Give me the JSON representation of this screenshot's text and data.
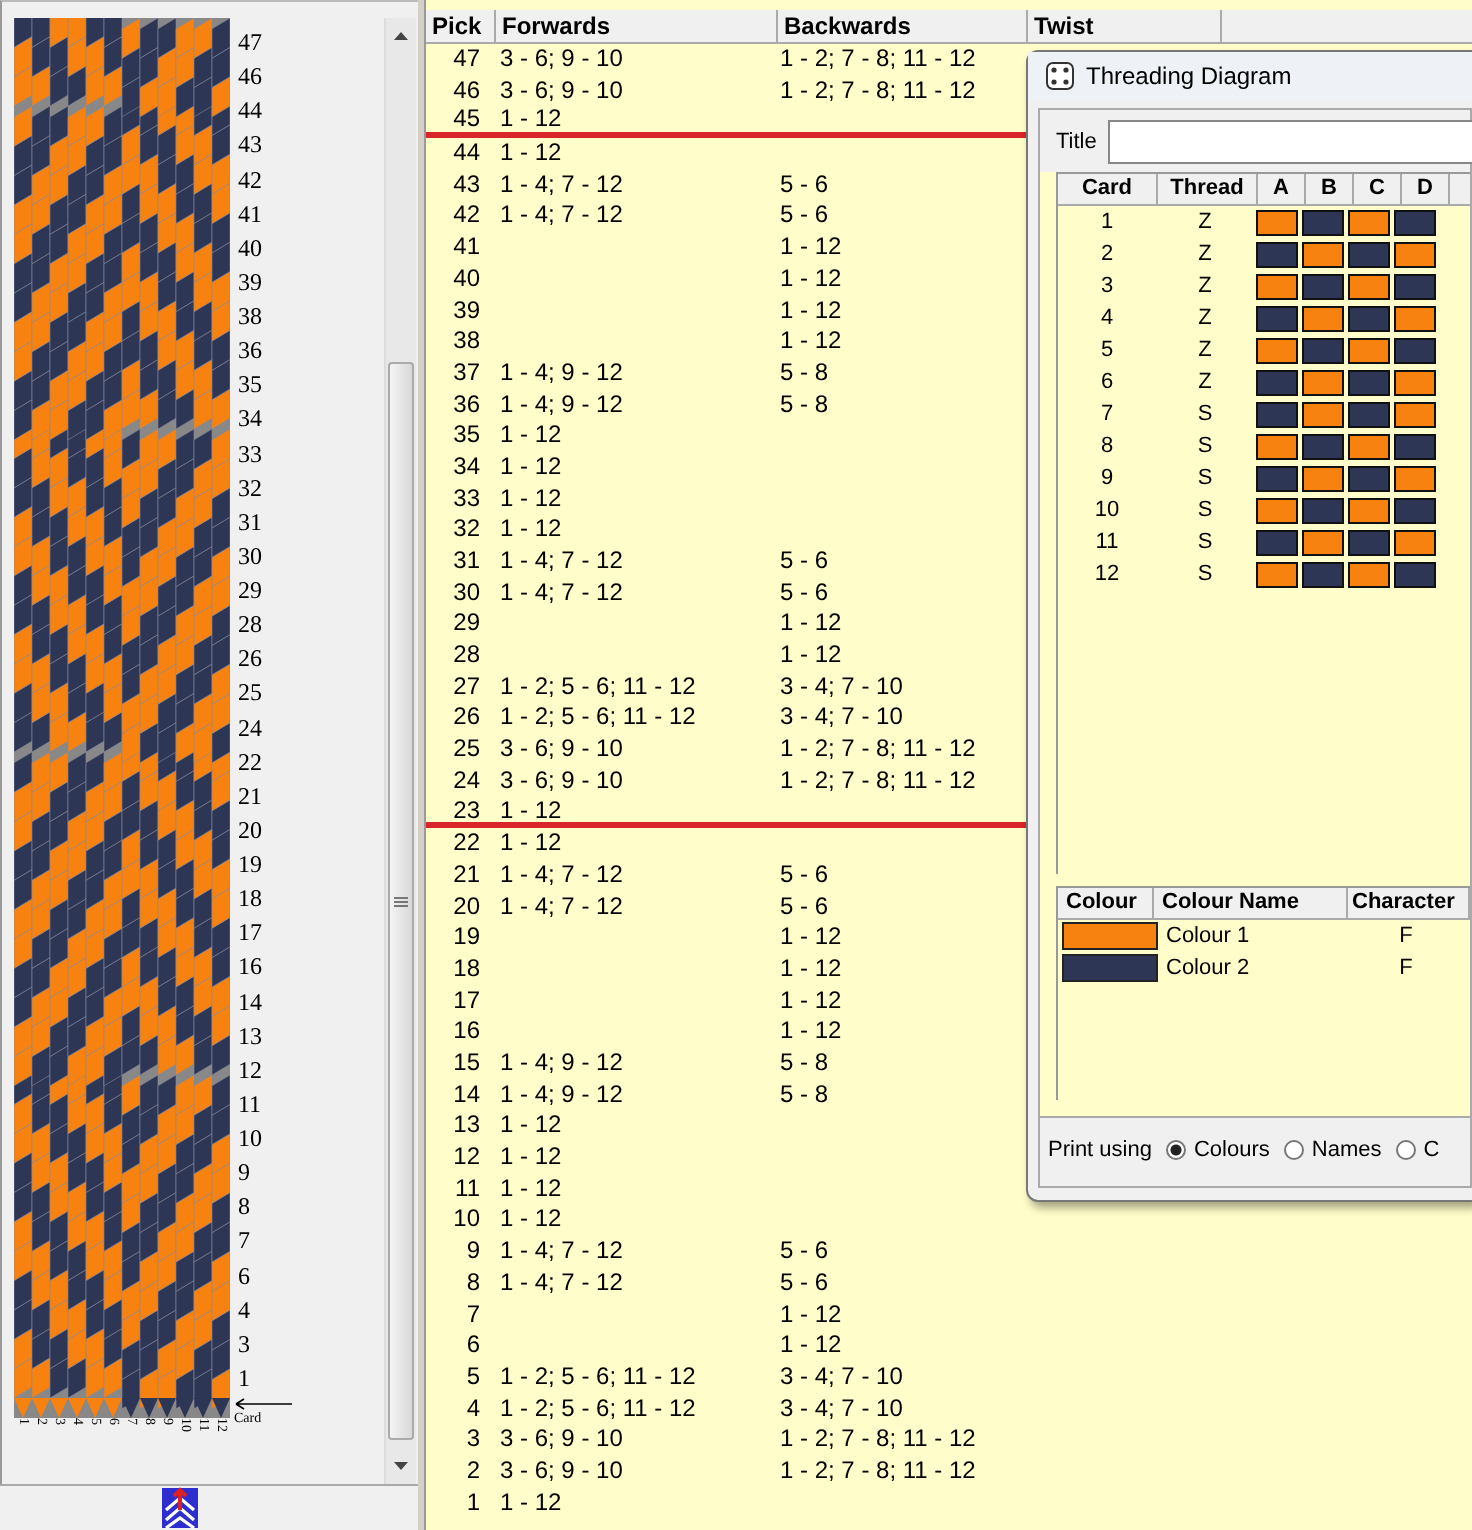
{
  "pattern_panel": {
    "pick_labels": [
      "47",
      "46",
      "44",
      "43",
      "42",
      "41",
      "40",
      "39",
      "38",
      "36",
      "35",
      "34",
      "33",
      "32",
      "31",
      "30",
      "29",
      "28",
      "26",
      "25",
      "24",
      "22",
      "21",
      "20",
      "19",
      "18",
      "17",
      "16",
      "14",
      "13",
      "12",
      "11",
      "10",
      "9",
      "8",
      "7",
      "6",
      "4",
      "3",
      "1"
    ],
    "card_numbers": [
      "1",
      "2",
      "3",
      "4",
      "5",
      "6",
      "7",
      "8",
      "9",
      "10",
      "11",
      "12"
    ],
    "card_label": "Card"
  },
  "pick_table": {
    "columns": [
      "Pick",
      "Forwards",
      "Backwards",
      "Twist"
    ],
    "rows": [
      {
        "pick": "47",
        "forwards": "3 - 6; 9 - 10",
        "backwards": "1 - 2; 7 - 8; 11 - 12",
        "divider_below": false
      },
      {
        "pick": "46",
        "forwards": "3 - 6; 9 - 10",
        "backwards": "1 - 2; 7 - 8; 11 - 12",
        "divider_below": false
      },
      {
        "pick": "45",
        "forwards": "1 - 12",
        "divider_below": true
      },
      {
        "pick": "44",
        "forwards": "1 - 12",
        "divider_below": false
      },
      {
        "pick": "43",
        "forwards": "1 - 4; 7 - 12",
        "backwards": "5 - 6",
        "divider_below": false
      },
      {
        "pick": "42",
        "forwards": "1 - 4; 7 - 12",
        "backwards": "5 - 6",
        "divider_below": false
      },
      {
        "pick": "41",
        "backwards": "1 - 12",
        "divider_below": false
      },
      {
        "pick": "40",
        "backwards": "1 - 12",
        "divider_below": false
      },
      {
        "pick": "39",
        "backwards": "1 - 12",
        "divider_below": false
      },
      {
        "pick": "38",
        "backwards": "1 - 12",
        "divider_below": false
      },
      {
        "pick": "37",
        "forwards": "1 - 4; 9 - 12",
        "backwards": "5 - 8",
        "divider_below": false
      },
      {
        "pick": "36",
        "forwards": "1 - 4; 9 - 12",
        "backwards": "5 - 8",
        "divider_below": false
      },
      {
        "pick": "35",
        "forwards": "1 - 12",
        "divider_below": false
      },
      {
        "pick": "34",
        "forwards": "1 - 12",
        "divider_below": false
      },
      {
        "pick": "33",
        "forwards": "1 - 12",
        "divider_below": false
      },
      {
        "pick": "32",
        "forwards": "1 - 12",
        "divider_below": false
      },
      {
        "pick": "31",
        "forwards": "1 - 4; 7 - 12",
        "backwards": "5 - 6",
        "divider_below": false
      },
      {
        "pick": "30",
        "forwards": "1 - 4; 7 - 12",
        "backwards": "5 - 6",
        "divider_below": false
      },
      {
        "pick": "29",
        "backwards": "1 - 12",
        "divider_below": false
      },
      {
        "pick": "28",
        "backwards": "1 - 12",
        "divider_below": false
      },
      {
        "pick": "27",
        "forwards": "1 - 2; 5 - 6; 11 - 12",
        "backwards": "3 - 4; 7 - 10",
        "divider_below": false
      },
      {
        "pick": "26",
        "forwards": "1 - 2; 5 - 6; 11 - 12",
        "backwards": "3 - 4; 7 - 10",
        "divider_below": false
      },
      {
        "pick": "25",
        "forwards": "3 - 6; 9 - 10",
        "backwards": "1 - 2; 7 - 8; 11 - 12",
        "divider_below": false
      },
      {
        "pick": "24",
        "forwards": "3 - 6; 9 - 10",
        "backwards": "1 - 2; 7 - 8; 11 - 12",
        "divider_below": false
      },
      {
        "pick": "23",
        "forwards": "1 - 12",
        "divider_below": true
      },
      {
        "pick": "22",
        "forwards": "1 - 12",
        "divider_below": false
      },
      {
        "pick": "21",
        "forwards": "1 - 4; 7 - 12",
        "backwards": "5 - 6",
        "divider_below": false
      },
      {
        "pick": "20",
        "forwards": "1 - 4; 7 - 12",
        "backwards": "5 - 6",
        "divider_below": false
      },
      {
        "pick": "19",
        "backwards": "1 - 12",
        "divider_below": false
      },
      {
        "pick": "18",
        "backwards": "1 - 12",
        "divider_below": false
      },
      {
        "pick": "17",
        "backwards": "1 - 12",
        "divider_below": false
      },
      {
        "pick": "16",
        "backwards": "1 - 12",
        "divider_below": false
      },
      {
        "pick": "15",
        "forwards": "1 - 4; 9 - 12",
        "backwards": "5 - 8",
        "divider_below": false
      },
      {
        "pick": "14",
        "forwards": "1 - 4; 9 - 12",
        "backwards": "5 - 8",
        "divider_below": false
      },
      {
        "pick": "13",
        "forwards": "1 - 12",
        "divider_below": false
      },
      {
        "pick": "12",
        "forwards": "1 - 12",
        "divider_below": false
      },
      {
        "pick": "11",
        "forwards": "1 - 12",
        "divider_below": false
      },
      {
        "pick": "10",
        "forwards": "1 - 12",
        "divider_below": false
      },
      {
        "pick": "9",
        "forwards": "1 - 4; 7 - 12",
        "backwards": "5 - 6",
        "divider_below": false
      },
      {
        "pick": "8",
        "forwards": "1 - 4; 7 - 12",
        "backwards": "5 - 6",
        "divider_below": false
      },
      {
        "pick": "7",
        "backwards": "1 - 12",
        "divider_below": false
      },
      {
        "pick": "6",
        "backwards": "1 - 12",
        "divider_below": false
      },
      {
        "pick": "5",
        "forwards": "1 - 2; 5 - 6; 11 - 12",
        "backwards": "3 - 4; 7 - 10",
        "divider_below": false
      },
      {
        "pick": "4",
        "forwards": "1 - 2; 5 - 6; 11 - 12",
        "backwards": "3 - 4; 7 - 10",
        "divider_below": false
      },
      {
        "pick": "3",
        "forwards": "3 - 6; 9 - 10",
        "backwards": "1 - 2; 7 - 8; 11 - 12",
        "divider_below": false
      },
      {
        "pick": "2",
        "forwards": "3 - 6; 9 - 10",
        "backwards": "1 - 2; 7 - 8; 11 - 12",
        "divider_below": false
      },
      {
        "pick": "1",
        "forwards": "1 - 12",
        "divider_below": false
      }
    ]
  },
  "threading_dialog": {
    "title": "Threading Diagram",
    "title_label": "Title",
    "columns": [
      "Card",
      "Thread",
      "A",
      "B",
      "C",
      "D"
    ],
    "cards": [
      {
        "card": "1",
        "thread": "Z",
        "holes": [
          {
            "color": "#f7820f"
          },
          {
            "color": "#2e3656"
          },
          {
            "color": "#f7820f"
          },
          {
            "color": "#2e3656"
          }
        ]
      },
      {
        "card": "2",
        "thread": "Z",
        "holes": [
          {
            "color": "#2e3656"
          },
          {
            "color": "#f7820f"
          },
          {
            "color": "#2e3656"
          },
          {
            "color": "#f7820f"
          }
        ]
      },
      {
        "card": "3",
        "thread": "Z",
        "holes": [
          {
            "color": "#f7820f"
          },
          {
            "color": "#2e3656"
          },
          {
            "color": "#f7820f"
          },
          {
            "color": "#2e3656"
          }
        ]
      },
      {
        "card": "4",
        "thread": "Z",
        "holes": [
          {
            "color": "#2e3656"
          },
          {
            "color": "#f7820f"
          },
          {
            "color": "#2e3656"
          },
          {
            "color": "#f7820f"
          }
        ]
      },
      {
        "card": "5",
        "thread": "Z",
        "holes": [
          {
            "color": "#f7820f"
          },
          {
            "color": "#2e3656"
          },
          {
            "color": "#f7820f"
          },
          {
            "color": "#2e3656"
          }
        ]
      },
      {
        "card": "6",
        "thread": "Z",
        "holes": [
          {
            "color": "#2e3656"
          },
          {
            "color": "#f7820f"
          },
          {
            "color": "#2e3656"
          },
          {
            "color": "#f7820f"
          }
        ]
      },
      {
        "card": "7",
        "thread": "S",
        "holes": [
          {
            "color": "#2e3656"
          },
          {
            "color": "#f7820f"
          },
          {
            "color": "#2e3656"
          },
          {
            "color": "#f7820f"
          }
        ]
      },
      {
        "card": "8",
        "thread": "S",
        "holes": [
          {
            "color": "#f7820f"
          },
          {
            "color": "#2e3656"
          },
          {
            "color": "#f7820f"
          },
          {
            "color": "#2e3656"
          }
        ]
      },
      {
        "card": "9",
        "thread": "S",
        "holes": [
          {
            "color": "#2e3656"
          },
          {
            "color": "#f7820f"
          },
          {
            "color": "#2e3656"
          },
          {
            "color": "#f7820f"
          }
        ]
      },
      {
        "card": "10",
        "thread": "S",
        "holes": [
          {
            "color": "#f7820f"
          },
          {
            "color": "#2e3656"
          },
          {
            "color": "#f7820f"
          },
          {
            "color": "#2e3656"
          }
        ]
      },
      {
        "card": "11",
        "thread": "S",
        "holes": [
          {
            "color": "#2e3656"
          },
          {
            "color": "#f7820f"
          },
          {
            "color": "#2e3656"
          },
          {
            "color": "#f7820f"
          }
        ]
      },
      {
        "card": "12",
        "thread": "S",
        "holes": [
          {
            "color": "#f7820f"
          },
          {
            "color": "#2e3656"
          },
          {
            "color": "#f7820f"
          },
          {
            "color": "#2e3656"
          }
        ]
      }
    ],
    "colour_columns": [
      "Colour",
      "Colour Name",
      "Character"
    ],
    "colours": [
      {
        "color": "#f7820f",
        "name": "Colour 1",
        "character": "F"
      },
      {
        "color": "#2e3656",
        "name": "Colour 2",
        "character": "F"
      }
    ],
    "print_label": "Print using",
    "print_options": [
      {
        "label": "Colours",
        "selected": true
      },
      {
        "label": "Names",
        "selected": false
      },
      {
        "label": "C",
        "selected": false
      }
    ]
  }
}
